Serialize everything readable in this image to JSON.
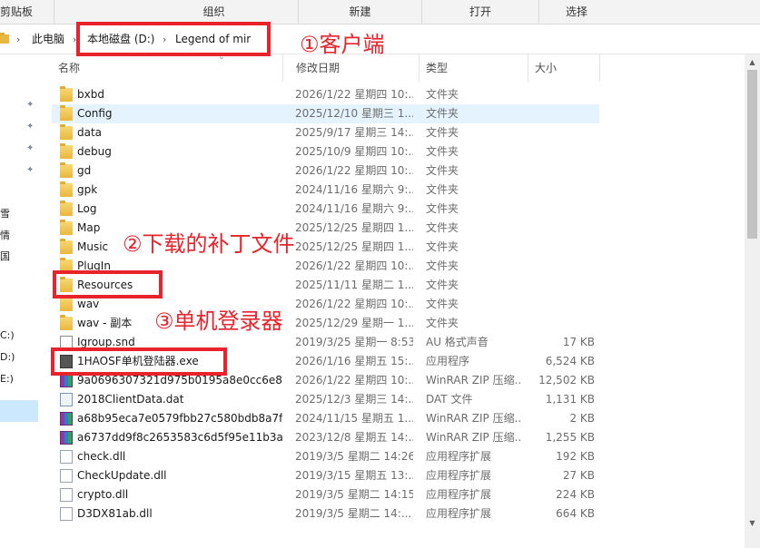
{
  "ribbon": {
    "groups": [
      "剪贴板",
      "组织",
      "新建",
      "打开",
      "选择"
    ]
  },
  "address": {
    "crumbs": [
      "此电脑",
      "本地磁盘 (D:)",
      "Legend of mir"
    ]
  },
  "nav": {
    "labels": [
      "雪",
      "情",
      "国",
      "C:)",
      "D:)",
      "E:)"
    ]
  },
  "columns": {
    "name": "名称",
    "date": "修改日期",
    "type": "类型",
    "size": "大小"
  },
  "files": [
    {
      "name": "bxbd",
      "date": "2026/1/22 星期四 10:...",
      "type": "文件夹",
      "size": "",
      "icon": "folder-icon"
    },
    {
      "name": "Config",
      "date": "2025/12/10 星期三 1...",
      "type": "文件夹",
      "size": "",
      "icon": "folder-icon"
    },
    {
      "name": "data",
      "date": "2025/9/17 星期三 14:...",
      "type": "文件夹",
      "size": "",
      "icon": "folder-icon"
    },
    {
      "name": "debug",
      "date": "2025/10/9 星期四 10:...",
      "type": "文件夹",
      "size": "",
      "icon": "folder-icon"
    },
    {
      "name": "gd",
      "date": "2026/1/22 星期四 10:...",
      "type": "文件夹",
      "size": "",
      "icon": "folder-icon"
    },
    {
      "name": "gpk",
      "date": "2024/11/16 星期六 9:...",
      "type": "文件夹",
      "size": "",
      "icon": "folder-icon"
    },
    {
      "name": "Log",
      "date": "2024/11/16 星期六 9:...",
      "type": "文件夹",
      "size": "",
      "icon": "folder-icon"
    },
    {
      "name": "Map",
      "date": "2025/12/25 星期四 1...",
      "type": "文件夹",
      "size": "",
      "icon": "folder-icon"
    },
    {
      "name": "Music",
      "date": "2025/12/25 星期四 1...",
      "type": "文件夹",
      "size": "",
      "icon": "folder-icon"
    },
    {
      "name": "PlugIn",
      "date": "2026/1/22 星期四 10:...",
      "type": "文件夹",
      "size": "",
      "icon": "folder-icon"
    },
    {
      "name": "Resources",
      "date": "2025/11/11 星期二 1...",
      "type": "文件夹",
      "size": "",
      "icon": "folder-icon"
    },
    {
      "name": "wav",
      "date": "2026/1/22 星期四 10:...",
      "type": "文件夹",
      "size": "",
      "icon": "folder-icon"
    },
    {
      "name": "wav - 副本",
      "date": "2025/12/29 星期一 1...",
      "type": "文件夹",
      "size": "",
      "icon": "folder-icon"
    },
    {
      "name": "Igroup.snd",
      "date": "2019/3/25 星期一 8:53",
      "type": "AU 格式声音",
      "size": "17 KB",
      "icon": "audio-file-icon"
    },
    {
      "name": "1HAOSF单机登陆器.exe",
      "date": "2026/1/16 星期五 15:...",
      "type": "应用程序",
      "size": "6,524 KB",
      "icon": "exe-icon"
    },
    {
      "name": "9a0696307321d975b0195a8e0cc6e87...",
      "date": "2026/1/22 星期四 10:...",
      "type": "WinRAR ZIP 压缩...",
      "size": "12,502 KB",
      "icon": "winrar-zip-icon"
    },
    {
      "name": "2018ClientData.dat",
      "date": "2025/12/3 星期三 14:...",
      "type": "DAT 文件",
      "size": "1,131 KB",
      "icon": "dat-file-icon"
    },
    {
      "name": "a68b95eca7e0579fbb27c580bdb8a7f...",
      "date": "2024/11/15 星期五 1...",
      "type": "WinRAR ZIP 压缩...",
      "size": "2 KB",
      "icon": "winrar-zip-icon"
    },
    {
      "name": "a6737dd9f8c2653583c6d5f95e11b3a...",
      "date": "2023/12/8 星期五 14:...",
      "type": "WinRAR ZIP 压缩...",
      "size": "1,255 KB",
      "icon": "winrar-zip-icon"
    },
    {
      "name": "check.dll",
      "date": "2019/3/5 星期二 14:26",
      "type": "应用程序扩展",
      "size": "192 KB",
      "icon": "dll-icon"
    },
    {
      "name": "CheckUpdate.dll",
      "date": "2019/3/15 星期五 13:...",
      "type": "应用程序扩展",
      "size": "27 KB",
      "icon": "dll-icon"
    },
    {
      "name": "crypto.dll",
      "date": "2019/3/5 星期二 14:15",
      "type": "应用程序扩展",
      "size": "224 KB",
      "icon": "dll-icon"
    },
    {
      "name": "D3DX81ab.dll",
      "date": "2019/3/5 星期二 14:...",
      "type": "应用程序扩展",
      "size": "664 KB",
      "icon": "dll-icon"
    }
  ],
  "annotations": {
    "client": "①客户端",
    "patch": "②下载的补丁文件",
    "launcher": "③单机登录器"
  },
  "colors": {
    "annotation_red": "#e8232b",
    "hover_row": "#e5f3ff",
    "selected_nav": "#cce8ff"
  }
}
